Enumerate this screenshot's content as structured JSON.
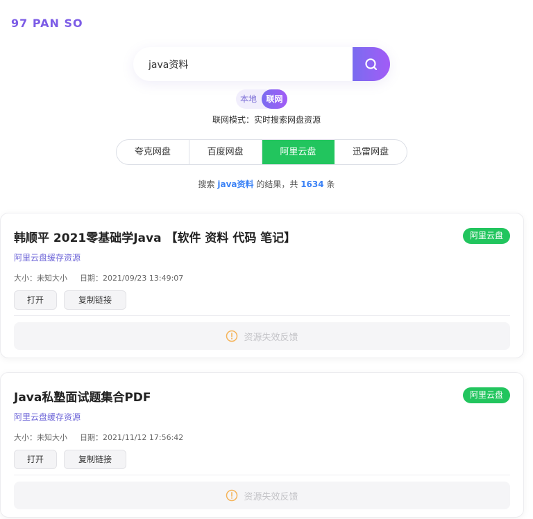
{
  "logo": "97 PAN SO",
  "search": {
    "value": "java资料",
    "placeholder": "",
    "button_icon": "search-icon"
  },
  "mode": {
    "local_label": "本地",
    "net_label": "联网",
    "description": "联网模式：实时搜索网盘资源"
  },
  "tabs": [
    {
      "label": "夸克网盘",
      "active": false
    },
    {
      "label": "百度网盘",
      "active": false
    },
    {
      "label": "阿里云盘",
      "active": true
    },
    {
      "label": "迅雷网盘",
      "active": false
    }
  ],
  "summary": {
    "prefix": "搜索",
    "keyword": "java资料",
    "middle": "的结果，共",
    "count": "1634",
    "suffix": "条"
  },
  "results": [
    {
      "title": "韩顺平 2021零基础学Java 【软件 资料 代码 笔记】",
      "badge": "阿里云盘",
      "source": "阿里云盘缓存资源",
      "size": "大小：未知大小",
      "date": "日期：2021/09/23 13:49:07",
      "open_label": "打开",
      "copy_label": "复制链接",
      "feedback_label": "资源失效反馈"
    },
    {
      "title": "Java私塾面试题集合PDF",
      "badge": "阿里云盘",
      "source": "阿里云盘缓存资源",
      "size": "大小：未知大小",
      "date": "日期：2021/11/12 17:56:42",
      "open_label": "打开",
      "copy_label": "复制链接",
      "feedback_label": "资源失效反馈"
    }
  ],
  "colors": {
    "brand": "#7c5ce6",
    "accent_green": "#22c55e",
    "link_blue": "#3b82f6",
    "feedback_icon": "#f5b45a"
  }
}
